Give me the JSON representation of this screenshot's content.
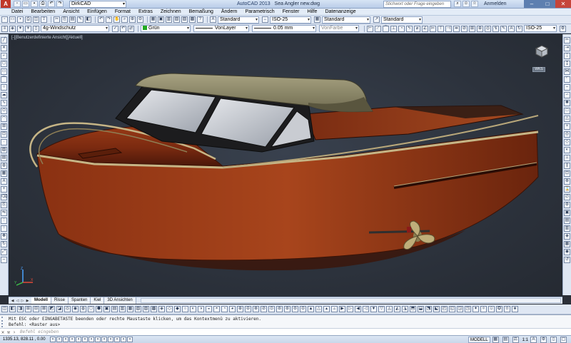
{
  "titlebar": {
    "app_button": "A",
    "workspace": "DirkCAD",
    "app_name": "AutoCAD 2013",
    "file_name": "Sea Angler new.dwg",
    "search_placeholder": "Stichwort oder Frage eingeben",
    "login": "Anmelden"
  },
  "menu": [
    "Datei",
    "Bearbeiten",
    "Ansicht",
    "Einfügen",
    "Format",
    "Extras",
    "Zeichnen",
    "Bemaßung",
    "Ändern",
    "Parametrisch",
    "Fenster",
    "Hilfe",
    "Datenanzeige"
  ],
  "toolbar1": {
    "text_style": "Standard",
    "dim_style": "ISO-25",
    "table_style": "Standard",
    "mleader_style": "Standard"
  },
  "toolbar2": {
    "layer": "4g-Windschutz",
    "color": "Grün",
    "color_hex": "#22aa22",
    "linetype": "VonLayer",
    "lineweight": "0.05 mm",
    "plotstyle": "VonFarbe",
    "dim_style2": "ISO-25"
  },
  "viewport": {
    "label": "[-][Benutzerdefinierte Ansicht][Aktuell]",
    "wcs": "WKS"
  },
  "tabs": [
    "Modell",
    "Risse",
    "Spanten",
    "Kiel",
    "3D Ansichten"
  ],
  "command": {
    "line1": "Mit ESC oder EINGABETASTE beenden oder rechte Maustaste klicken, um das Kontextmenü zu aktivieren.",
    "line2": "Befehl:  <Raster aus>",
    "prompt": "Befehl eingeben"
  },
  "status": {
    "coords": "1335.13, 828.11 , 0.00",
    "mode": "MODELL",
    "scale": "1:1"
  },
  "colors": {
    "hull": "#7a2a10",
    "canopy": "#8f8a68",
    "trim": "#b8a77a",
    "background": "#2c323c"
  }
}
